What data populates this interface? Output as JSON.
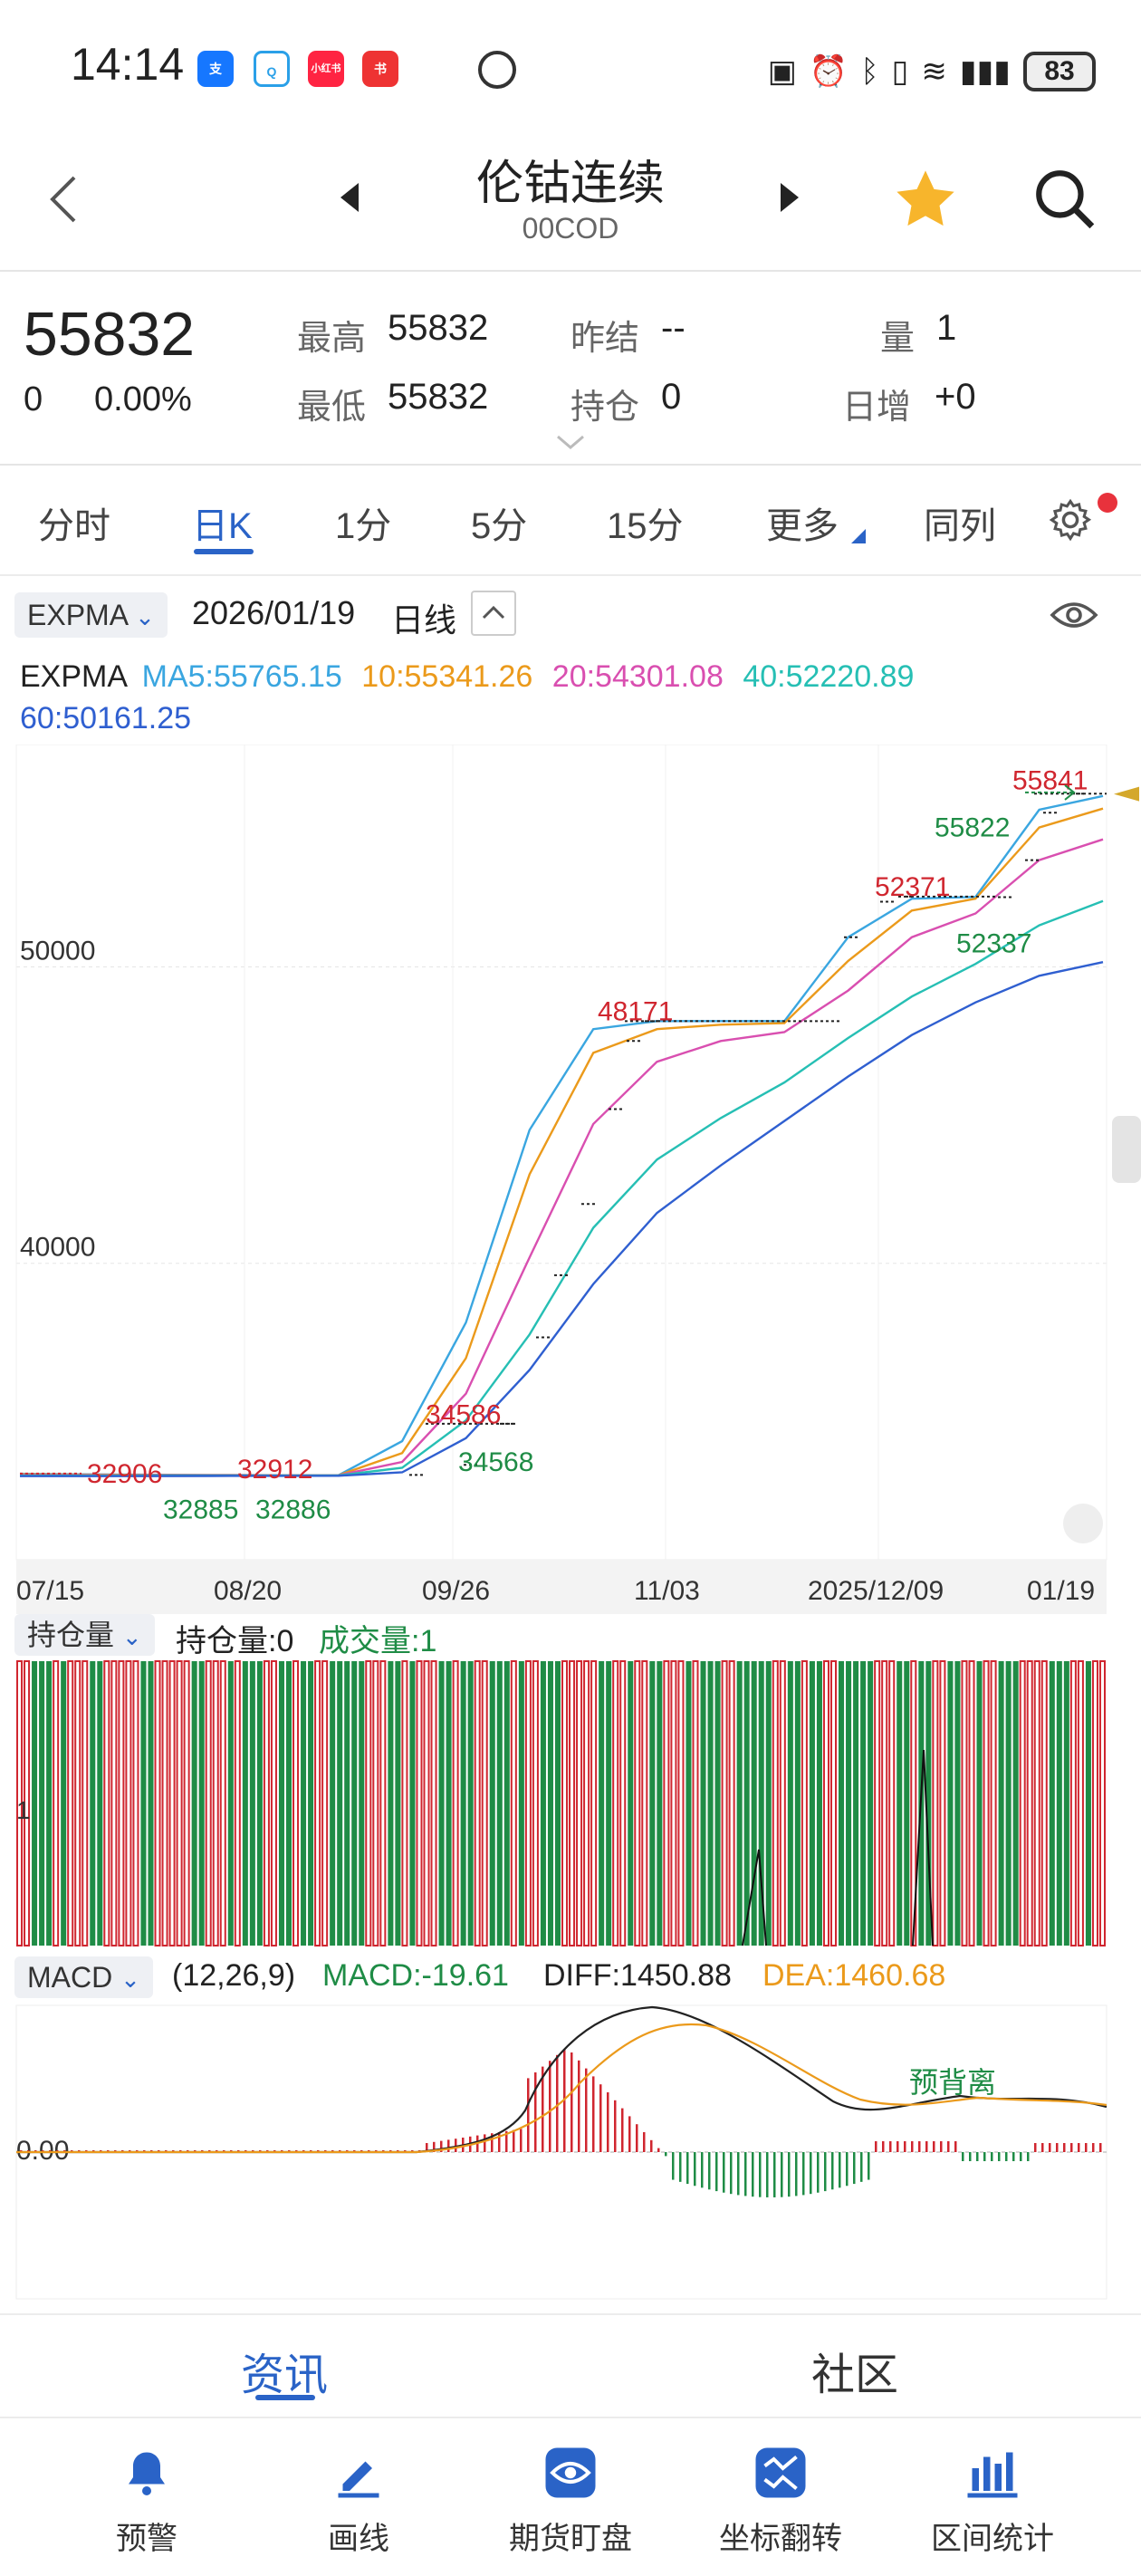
{
  "status_bar": {
    "time": "14:14",
    "apps": [
      "支",
      "Q",
      "小红书",
      "书"
    ],
    "battery": "83"
  },
  "header": {
    "title": "伦钴连续",
    "code": "00COD"
  },
  "quote": {
    "price": "55832",
    "change": "0",
    "change_pct": "0.00%",
    "high_label": "最高",
    "high": "55832",
    "low_label": "最低",
    "low": "55832",
    "prev_settle_label": "昨结",
    "prev_settle": "--",
    "open_interest_label": "持仓",
    "open_interest": "0",
    "volume_label": "量",
    "volume": "1",
    "daily_add_label": "日增",
    "daily_add": "+0"
  },
  "period_tabs": [
    "分时",
    "日K",
    "1分",
    "5分",
    "15分",
    "更多",
    "同列"
  ],
  "active_tab": "日K",
  "chart_toolbar": {
    "indicator": "EXPMA",
    "date": "2026/01/19",
    "period": "日线"
  },
  "ma_legend": {
    "prefix": "EXPMA",
    "ma5": "MA5:55765.15",
    "ma10": "10:55341.26",
    "ma20": "20:54301.08",
    "ma40": "40:52220.89",
    "ma60": "60:50161.25"
  },
  "colors": {
    "up": "#d0262f",
    "down": "#1f8c46",
    "ma5": "#3aa6e0",
    "ma10": "#eb9a1b",
    "ma20": "#d94fb0",
    "ma40": "#26bfb4",
    "ma60": "#2f5fd0",
    "accent": "#2a63c7"
  },
  "main_chart": {
    "y_ticks": [
      "50000",
      "40000"
    ],
    "x_ticks": [
      "07/15",
      "08/20",
      "09/26",
      "11/03",
      "2025/12/09",
      "01/19"
    ],
    "annotations": {
      "a1": "32906",
      "a2": "32912",
      "a3": "32885",
      "a4": "32886",
      "a5": "34586",
      "a6": "34568",
      "a7": "48171",
      "a8": "52371",
      "a9": "52337",
      "a10": "55841",
      "a11": "55822"
    }
  },
  "chart_data": [
    {
      "type": "line",
      "title": "",
      "x_ticks": [
        "07/15",
        "08/20",
        "09/26",
        "11/03",
        "2025/12/09",
        "01/19"
      ],
      "ylim": [
        30000,
        57500
      ],
      "series": [
        {
          "name": "MA5",
          "values": [
            32900,
            32880,
            32870,
            32860,
            32850,
            32850,
            34000,
            38000,
            44500,
            47900,
            48170,
            48170,
            48170,
            51000,
            52300,
            52360,
            55300,
            55765
          ]
        },
        {
          "name": "10",
          "values": [
            32880,
            32870,
            32860,
            32855,
            32850,
            32850,
            33600,
            36800,
            43000,
            47100,
            47900,
            48050,
            48100,
            50200,
            51900,
            52300,
            54700,
            55341
          ]
        },
        {
          "name": "20",
          "values": [
            32860,
            32855,
            32850,
            32848,
            32848,
            32848,
            33300,
            35600,
            40200,
            44700,
            46800,
            47500,
            47800,
            49200,
            51000,
            51800,
            53600,
            54301
          ]
        },
        {
          "name": "40",
          "values": [
            32840,
            32840,
            32840,
            32840,
            32842,
            32842,
            33100,
            34700,
            37600,
            41200,
            43500,
            44900,
            46100,
            47600,
            49000,
            50100,
            51400,
            52220
          ]
        },
        {
          "name": "60",
          "values": [
            32820,
            32820,
            32820,
            32825,
            32830,
            32832,
            32950,
            34100,
            36400,
            39300,
            41700,
            43300,
            44800,
            46300,
            47700,
            48800,
            49700,
            50161
          ]
        }
      ]
    },
    {
      "type": "bar",
      "title": "",
      "legend": [
        "持仓量:0",
        "成交量:1"
      ],
      "y_tick": "1"
    },
    {
      "type": "line",
      "title": "",
      "legend": [
        "(12,26,9)",
        "MACD:-19.61",
        "DIFF:1450.88",
        "DEA:1460.68"
      ],
      "y_tick": "0.00",
      "annotation": "预背离"
    }
  ],
  "volume_panel": {
    "selector": "持仓量",
    "oi_text": "持仓量:0",
    "vol_text": "成交量:1",
    "y_tick": "1"
  },
  "macd_panel": {
    "selector": "MACD",
    "params": "(12,26,9)",
    "macd": "MACD:-19.61",
    "diff": "DIFF:1450.88",
    "dea": "DEA:1460.68",
    "zero": "0.00",
    "note": "预背离"
  },
  "bottom_tabs": [
    "资讯",
    "社区"
  ],
  "nav": [
    "预警",
    "画线",
    "期货盯盘",
    "坐标翻转",
    "区间统计"
  ]
}
